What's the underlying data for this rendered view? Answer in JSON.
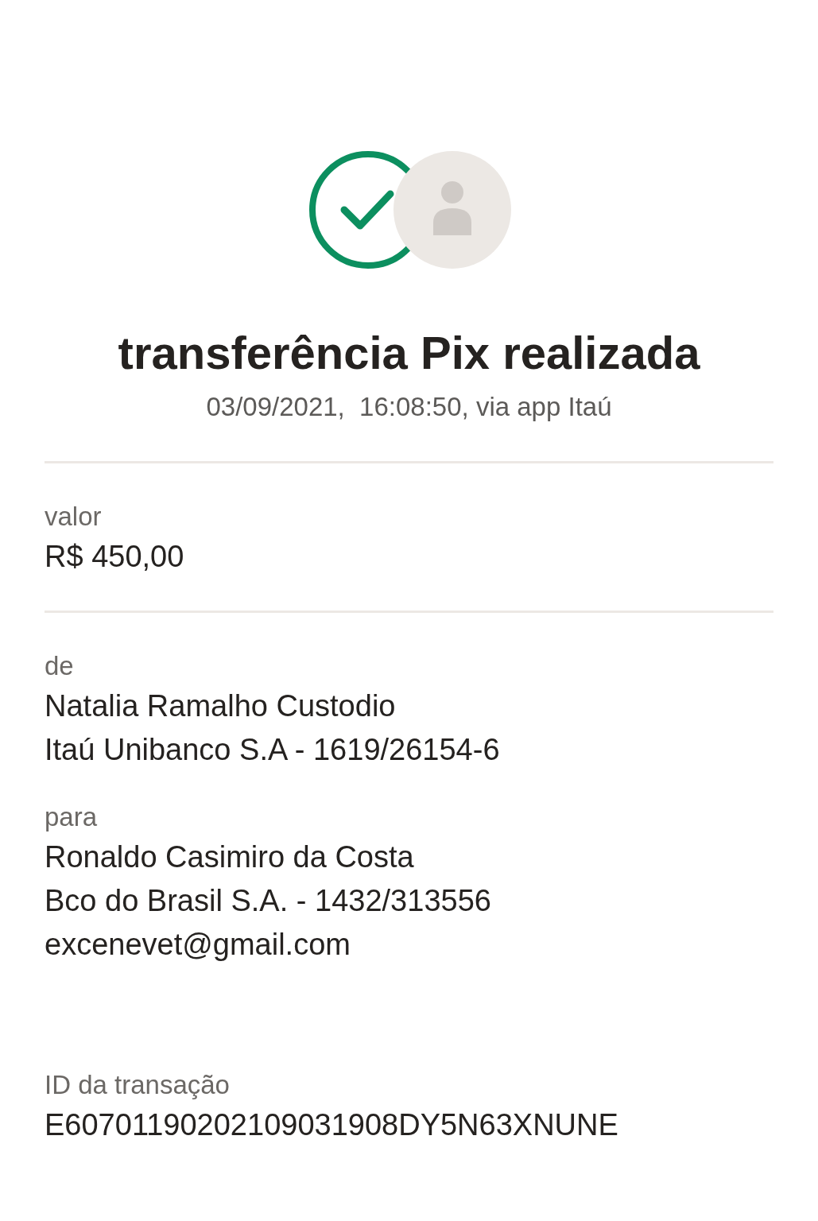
{
  "header": {
    "title": "transferência Pix realizada",
    "subtitle": "03/09/2021,  16:08:50, via app Itaú"
  },
  "groups": [
    {
      "fields": [
        {
          "label": "valor",
          "lines": [
            "R$ 450,00"
          ]
        }
      ]
    },
    {
      "fields": [
        {
          "label": "de",
          "lines": [
            "Natalia Ramalho Custodio",
            "Itaú Unibanco S.A - 1619/26154-6"
          ]
        },
        {
          "label": "para",
          "lines": [
            "Ronaldo Casimiro da Costa",
            "Bco do Brasil S.A. - 1432/313556",
            "excenevet@gmail.com"
          ]
        },
        {
          "label": "ID da transação",
          "lines": [
            "E60701190202109031908DY5N63XNUNE"
          ]
        }
      ]
    }
  ]
}
